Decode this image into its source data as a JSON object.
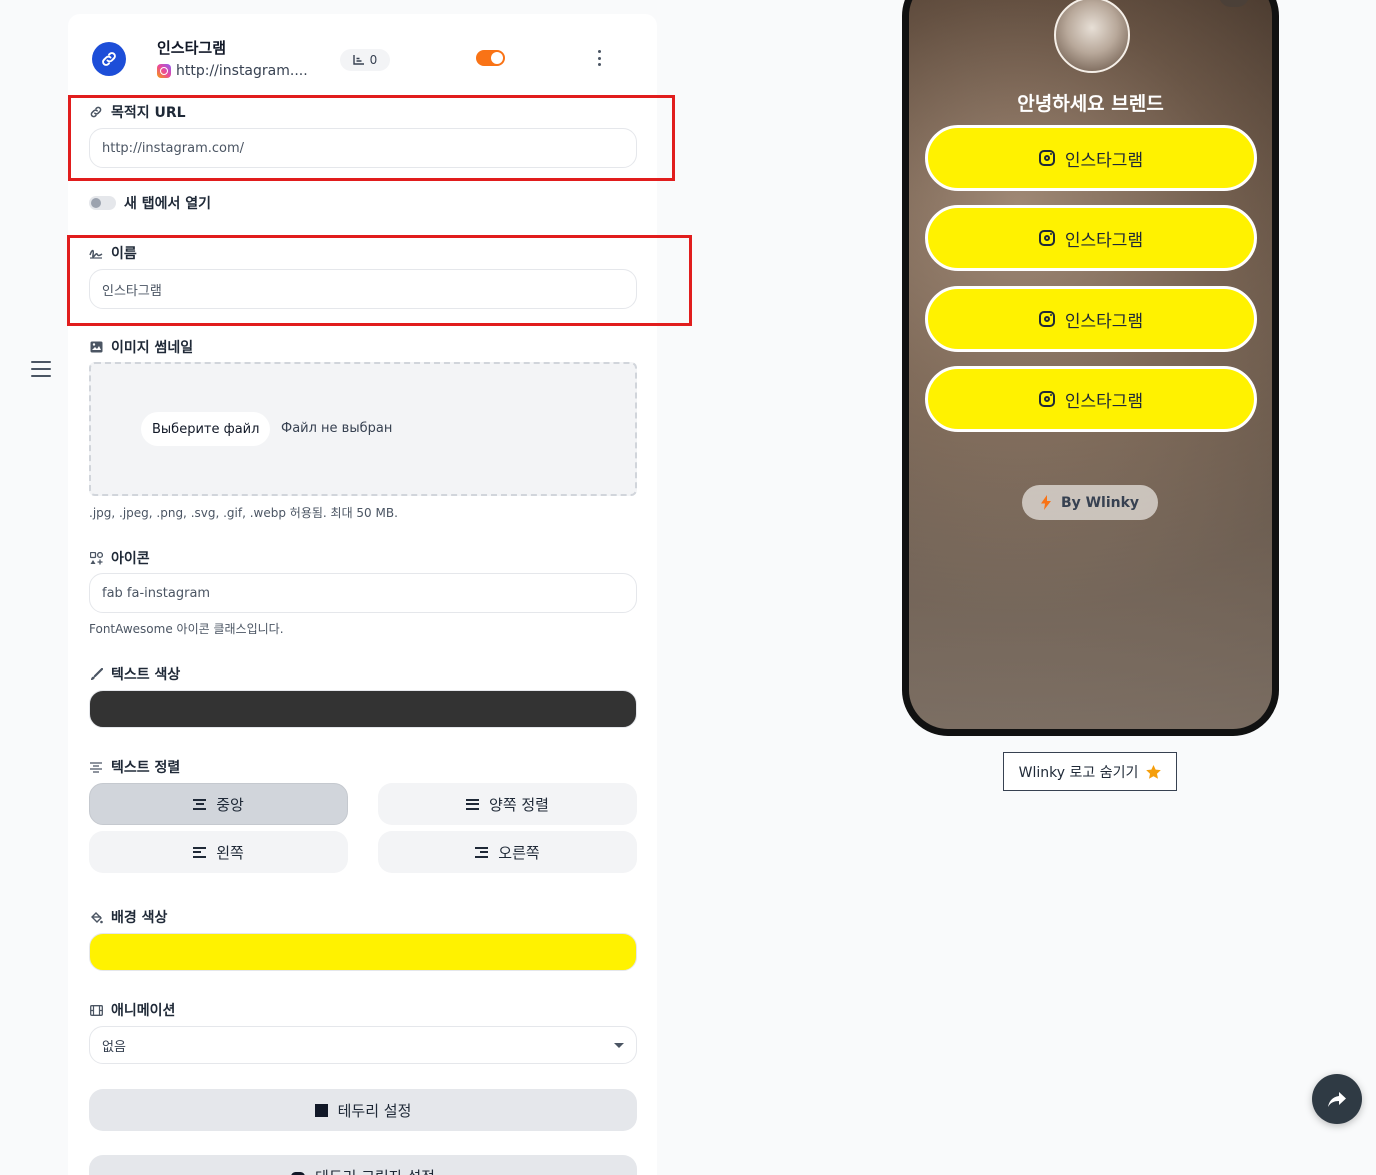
{
  "header": {
    "title": "인스타그램",
    "url": "http://instagram....",
    "click_count": "0"
  },
  "fields": {
    "destination_label": "목적지 URL",
    "destination_value": "http://instagram.com/",
    "new_tab_label": "새 탭에서 열기",
    "name_label": "이름",
    "name_value": "인스타그램",
    "thumbnail_label": "이미지 썸네일",
    "file_button": "Выберите файл",
    "file_status": "Файл не выбран",
    "file_hint": ".jpg, .jpeg, .png, .svg, .gif, .webp 허용됨. 최대 50 MB.",
    "icon_label": "아이콘",
    "icon_value": "fab fa-instagram",
    "icon_hint": "FontAwesome 아이콘 클래스입니다.",
    "text_color_label": "텍스트 색상",
    "text_color_value": "#333333",
    "text_align_label": "텍스트 정렬",
    "align_options": [
      "중앙",
      "양쪽 정렬",
      "왼쪽",
      "오른쪽"
    ],
    "align_selected": "중앙",
    "bg_color_label": "배경 색상",
    "bg_color_value": "#fff200",
    "animation_label": "애니메이션",
    "animation_value": "없음",
    "border_button": "테두리 설정",
    "shadow_button": "테두리 그림자 설정"
  },
  "preview": {
    "brand_title": "안녕하세요 브렌드",
    "links": [
      "인스타그램",
      "인스타그램",
      "인스타그램",
      "인스타그램"
    ],
    "by_label": "By Wlinky",
    "hide_logo_button": "Wlinky 로고 숨기기"
  },
  "colors": {
    "accent_orange": "#f97316",
    "link_icon_blue": "#1d4ed8",
    "highlight_red": "#e11d1d",
    "link_button_yellow": "#fff200"
  },
  "icons": [
    "menu-icon",
    "link-icon",
    "instagram-icon",
    "stats-icon",
    "more-vertical-icon",
    "image-icon",
    "icons-grid-icon",
    "brush-icon",
    "align-icon",
    "paint-bucket-icon",
    "film-icon",
    "square-icon",
    "cloud-icon",
    "bolt-icon",
    "star-icon",
    "share-icon"
  ]
}
